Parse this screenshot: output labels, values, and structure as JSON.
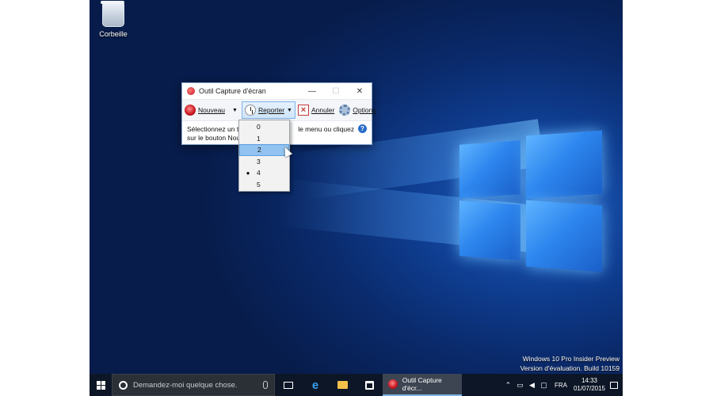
{
  "desktop": {
    "icons": [
      {
        "label": "Corbeille",
        "icon": "recycle-bin-icon"
      }
    ],
    "watermark": {
      "line1": "Windows 10 Pro Insider Preview",
      "line2": "Version d'évaluation. Build 10159"
    }
  },
  "window": {
    "title": "Outil Capture d'écran",
    "controls": {
      "minimize": "—",
      "maximize": "☐",
      "close": "✕"
    },
    "toolbar": {
      "new_label": "Nouveau",
      "delay_label": "Reporter",
      "cancel_label": "Annuler",
      "options_label": "Options"
    },
    "message_line1": "Sélectionnez un typ",
    "message_line1_end": "le menu ou cliquez",
    "message_line2": "sur le bouton Nouv",
    "help": "?"
  },
  "delay_menu": {
    "options": [
      "0",
      "1",
      "2",
      "3",
      "4",
      "5"
    ],
    "selected": "4",
    "hovered": "2"
  },
  "taskbar": {
    "search_placeholder": "Demandez-moi quelque chose.",
    "pinned": [
      "task-view-icon",
      "edge-icon",
      "file-explorer-icon",
      "store-icon"
    ],
    "active_app_label": "Outil Capture d'écr...",
    "tray": {
      "language": "FRA",
      "time": "14:33",
      "date": "01/07/2015"
    }
  },
  "colors": {
    "accent": "#7fb3e6",
    "taskbar": "#0c1626",
    "desktop_blue": "#0f3e92"
  }
}
